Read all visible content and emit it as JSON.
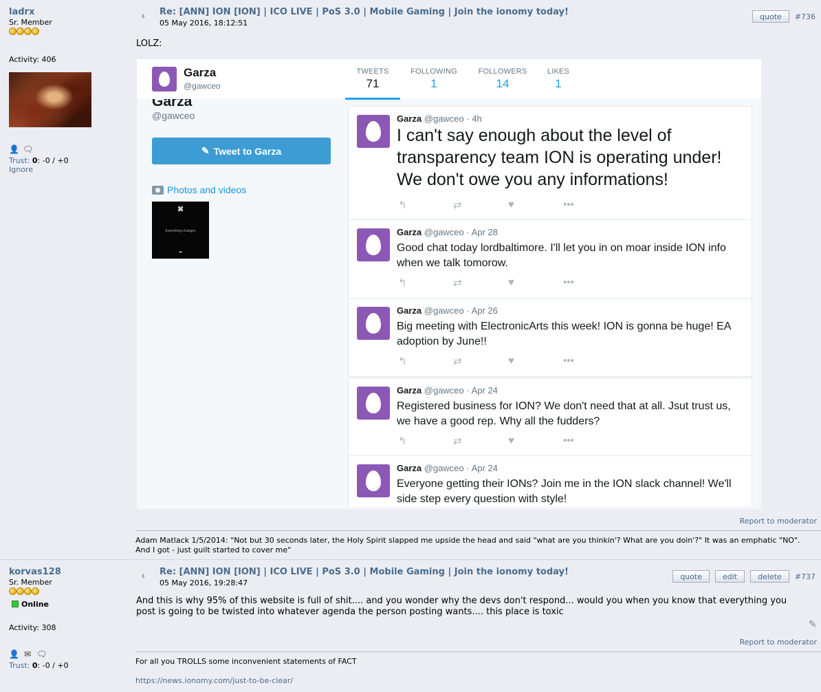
{
  "post1": {
    "username": "ladrx",
    "rank": "Sr. Member",
    "activity_label": "Activity:",
    "activity": "406",
    "trust_label": "Trust:",
    "trust_score": "0",
    "trust_detail": ": -0 / +0",
    "ignore": "Ignore",
    "title": "Re: [ANN] ION [ION] | ICO LIVE | PoS 3.0 | Mobile Gaming | Join the ionomy today!",
    "date": "05 May 2016, 18:12:51",
    "quote_label": "quote",
    "msg_number": "#736",
    "body": "LOLZ:",
    "report": "Report to moderator",
    "signature_line1": "Adam Matlack 1/5/2014: \"Not but 30 seconds later, the Holy Spirit slapped me upside the head and said \"what are you thinkin'? What are you doin'?\" It was an emphatic \"NO\".",
    "signature_line2": "And I got - just guilt started to cover me\""
  },
  "twitter": {
    "name": "Garza",
    "handle": "@gawceo",
    "stats": [
      {
        "label": "TWEETS",
        "value": "71"
      },
      {
        "label": "FOLLOWING",
        "value": "1"
      },
      {
        "label": "FOLLOWERS",
        "value": "14"
      },
      {
        "label": "LIKES",
        "value": "1"
      }
    ],
    "tweet_to": "Tweet to Garza",
    "photos_label": "Photos and videos",
    "thumb_text": "Everything changes",
    "tweets": [
      {
        "name": "Garza",
        "meta": "@gawceo · 4h",
        "text": "I can't say enough about the level of transparency team ION is operating under! We don't owe you any informations!"
      },
      {
        "name": "Garza",
        "meta": "@gawceo · Apr 28",
        "text": "Good chat today lordbaltimore. I'll let you in on moar inside ION info when we talk tomorow."
      },
      {
        "name": "Garza",
        "meta": "@gawceo · Apr 26",
        "text": "Big meeting with ElectronicArts this week! ION is gonna be huge! EA adoption by June!!"
      },
      {
        "name": "Garza",
        "meta": "@gawceo · Apr 24",
        "text": "Registered business for ION? We don't need that at all. Jsut trust us, we have a good rep. Why all the fudders?"
      },
      {
        "name": "Garza",
        "meta": "@gawceo · Apr 24",
        "text": "Everyone getting their IONs? Join me in the ION slack channel! We'll side step every question with style!"
      }
    ],
    "icons": [
      "reply-icon",
      "retweet-icon",
      "like-icon",
      "more-icon"
    ]
  },
  "post2": {
    "username": "korvas128",
    "rank": "Sr. Member",
    "online": "Online",
    "activity_label": "Activity:",
    "activity": "308",
    "trust_label": "Trust:",
    "trust_score": "0",
    "trust_detail": ": -0 / +0",
    "title": "Re: [ANN] ION [ION] | ICO LIVE | PoS 3.0 | Mobile Gaming | Join the ionomy today!",
    "date": "05 May 2016, 19:28:47",
    "quote_label": "quote",
    "edit_label": "edit",
    "delete_label": "delete",
    "msg_number": "#737",
    "body_line1": "And this is why 95% of this website is full of shit.... and you wonder why the devs don't respond... would you when you know that everything you",
    "body_line2": "post is going to be twisted into whatever agenda the person posting wants.... this place is toxic",
    "report": "Report to moderator",
    "signature_line1": "For all you TROLLS some inconvenient statements of FACT",
    "signature_link": "https://news.ionomy.com/just-to-be-clear/"
  },
  "colors": {
    "link": "#476c8e",
    "twitter_blue": "#1da1f2",
    "egg_purple": "#8c58b6",
    "page_bg": "#ecedf3"
  }
}
